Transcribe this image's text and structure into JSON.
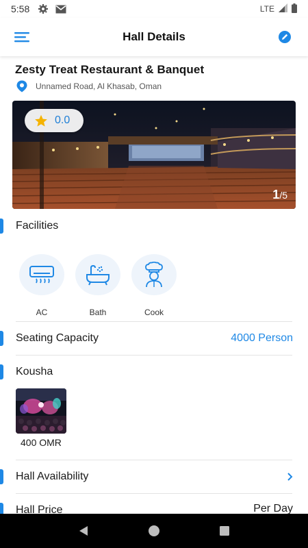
{
  "status_bar": {
    "time": "5:58",
    "network": "LTE"
  },
  "header": {
    "title": "Hall Details"
  },
  "venue": {
    "name": "Zesty Treat Restaurant & Banquet",
    "address": "Unnamed Road, Al Khasab, Oman",
    "rating": "0.0",
    "image_index": "1",
    "image_total": "/5"
  },
  "facilities": {
    "title": "Facilities",
    "items": [
      {
        "label": "AC",
        "icon": "air-conditioner-icon"
      },
      {
        "label": "Bath",
        "icon": "bathtub-icon"
      },
      {
        "label": "Cook",
        "icon": "chef-icon"
      }
    ]
  },
  "seating": {
    "label": "Seating Capacity",
    "value": "4000 Person"
  },
  "kousha": {
    "title": "Kousha",
    "price": "400 OMR"
  },
  "availability": {
    "label": "Hall Availability"
  },
  "price": {
    "label": "Hall Price",
    "value": "Per Day"
  },
  "colors": {
    "accent": "#1e88e5",
    "rating_text": "#1f7fd6",
    "star": "#f5b301"
  }
}
